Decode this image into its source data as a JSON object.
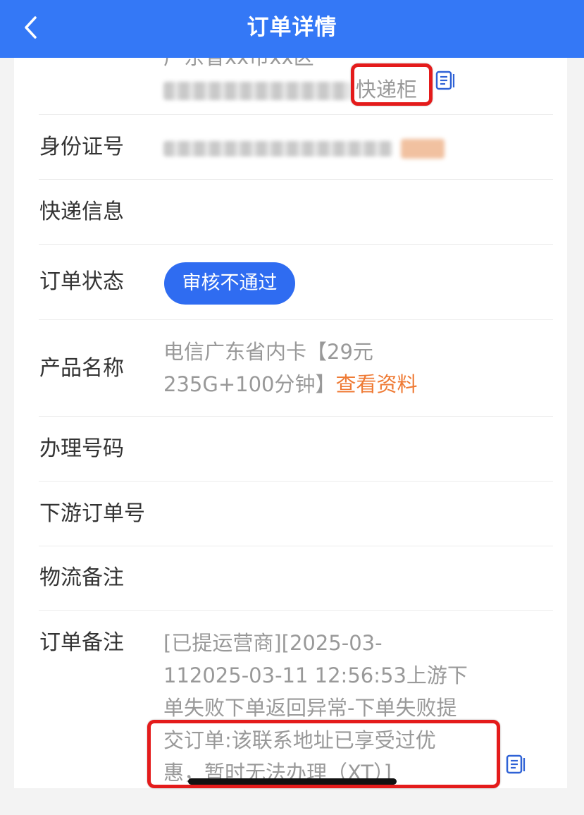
{
  "header": {
    "title": "订单详情",
    "back_icon": "chevron-left-icon"
  },
  "address": {
    "partial_top": "广东省xx市xx区",
    "tag": "快递柜",
    "copy_icon": "copy-icon"
  },
  "fields": {
    "id_label": "身份证号",
    "express_label": "快递信息",
    "status_label": "订单状态",
    "status_value": "审核不通过",
    "product_label": "产品名称",
    "product_line1": "电信广东省内卡【29元",
    "product_line2": "235G+100分钟】",
    "product_link": "查看资料",
    "phone_label": "办理号码",
    "downstream_label": "下游订单号",
    "logistics_label": "物流备注",
    "remark_label": "订单备注",
    "remark_lines": [
      "[已提运营商][2025-03-",
      "112025-03-11 12:56:53上游下",
      "单失败下单返回异常-下单失败提",
      "交订单:该联系地址已享受过优",
      "惠，暂时无法办理（XT）]"
    ]
  },
  "colors": {
    "header_bg": "#3478f6",
    "badge_bg": "#2f6cf1",
    "link": "#ef7a34",
    "highlight": "#e41b1b"
  }
}
